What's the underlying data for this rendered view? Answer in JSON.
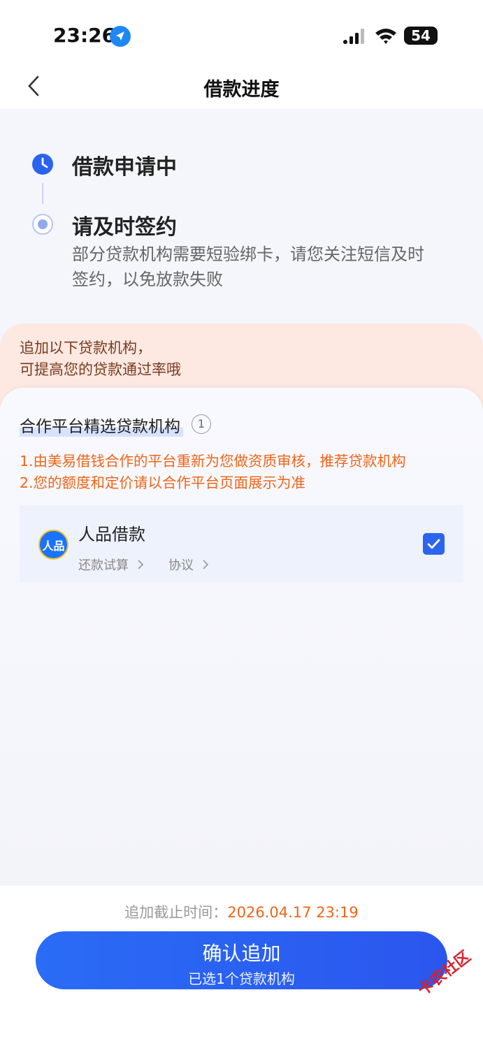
{
  "status_bar": {
    "time": "23:26",
    "battery": "54",
    "icons": [
      "location-arrow-icon",
      "signal-icon",
      "wifi-icon",
      "battery-icon"
    ]
  },
  "nav": {
    "title": "借款进度",
    "back_icon": "chevron-left-icon"
  },
  "progress": {
    "steps": [
      {
        "label": "借款申请中",
        "icon": "clock-icon",
        "state": "active"
      },
      {
        "label": "请及时签约",
        "icon": "radio-dot-icon",
        "state": "pending",
        "description": "部分贷款机构需要短验绑卡，请您关注短信及时签约，以免放款失败"
      }
    ]
  },
  "promo": {
    "line1": "追加以下贷款机构，",
    "line2": "可提高您的贷款通过率哦"
  },
  "section": {
    "title": "合作平台精选贷款机构",
    "count": "1",
    "note1": "1.由美易借钱合作的平台重新为您做资质审核，推荐贷款机构",
    "note2": "2.您的额度和定价请以合作平台页面展示为准"
  },
  "lenders": [
    {
      "name": "人品借款",
      "logo_text": "人品",
      "link1": "还款试算",
      "link2": "协议",
      "checked": true
    }
  ],
  "footer": {
    "deadline_label": "追加截止时间：",
    "deadline_value": "2026.04.17 23:19",
    "confirm_label": "确认追加",
    "confirm_sub": "已选1个贷款机构"
  },
  "watermark": "卡农社区",
  "colors": {
    "accent": "#2a63ee",
    "warning": "#f06418",
    "promo_bg": "#fde9e2"
  }
}
